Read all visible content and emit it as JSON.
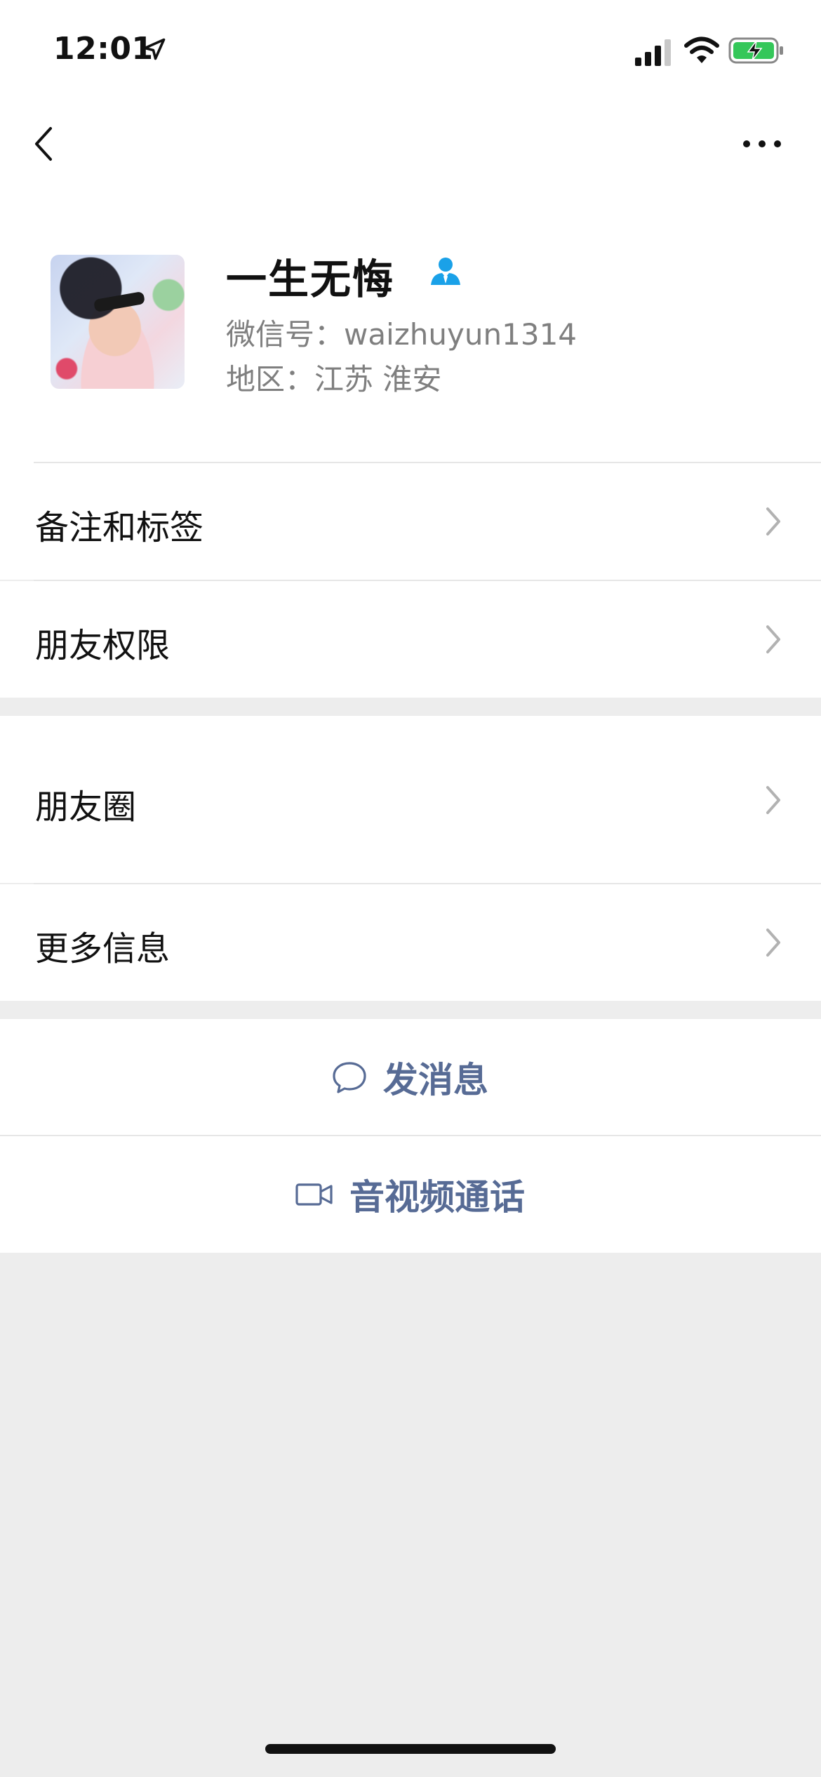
{
  "status_bar": {
    "time": "12:01",
    "icons": [
      "location-arrow-icon",
      "cellular-signal-icon",
      "wifi-icon",
      "battery-charging-icon"
    ],
    "battery_color": "#34c759"
  },
  "nav": {
    "back_icon": "chevron-left-icon",
    "more_icon": "ellipsis-icon"
  },
  "profile": {
    "name": "一生无悔",
    "wechat_id": "微信号：waizhuyun1314",
    "region": "地区：江苏 淮安",
    "verified_icon_color": "#1aa1e8"
  },
  "menu_group_1": [
    {
      "label": "备注和标签"
    },
    {
      "label": "朋友权限"
    }
  ],
  "menu_group_2": [
    {
      "label": "朋友圈"
    },
    {
      "label": "更多信息"
    }
  ],
  "actions": {
    "send_message": "发消息",
    "video_call": "音视频通话"
  },
  "colors": {
    "link_blue": "#576b95",
    "background": "#ededed",
    "secondary_text": "#7f7f7f"
  }
}
